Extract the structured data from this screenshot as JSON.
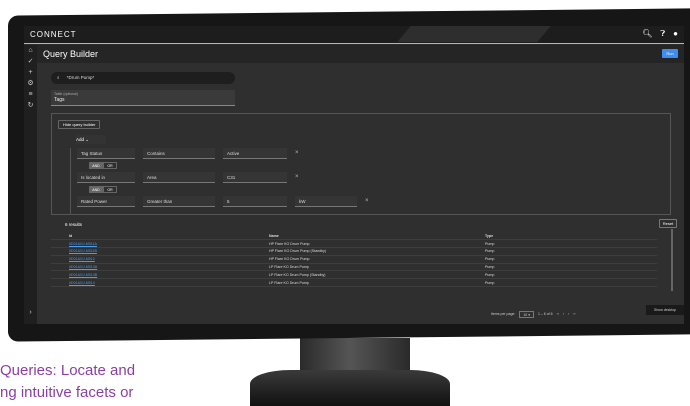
{
  "app": {
    "brand": "CONNECT",
    "title": "Query Builder",
    "run_label": "Run"
  },
  "topbar_icons": [
    "search-icon",
    "help-icon",
    "account-icon"
  ],
  "sidenav_icons": [
    "home-icon",
    "check-circle-icon",
    "plus-icon",
    "gear-icon",
    "hierarchy-icon",
    "history-icon"
  ],
  "search": {
    "value": "*Drum Pump*"
  },
  "table_field": {
    "label": "Table (optional)",
    "value": "Tags"
  },
  "query_builder": {
    "hide_label": "Hide query builder",
    "add_label": "Add",
    "rules": [
      {
        "field": "Tag Status",
        "operator": "Contains",
        "value": "Active",
        "unit": ""
      },
      {
        "field": "Is located in",
        "operator": "Area",
        "value": "C31",
        "unit": ""
      },
      {
        "field": "Rated Power",
        "operator": "Greater than",
        "value": "5",
        "unit": "kW"
      }
    ],
    "and_label": "AND",
    "or_label": "OR"
  },
  "results": {
    "count_label": "6 results",
    "reset_label": "Reset",
    "columns": [
      "Id",
      "Name",
      "Type"
    ],
    "rows": [
      {
        "id": "0D01AGJ-M011A",
        "name": "HP Flare KO Drum Pump",
        "type": "Pump"
      },
      {
        "id": "0D01AGJ-M011B",
        "name": "HP Flare KO Drum Pump (Standby)",
        "type": "Pump"
      },
      {
        "id": "0D01AGJ-M012",
        "name": "HP Flare KO Drum Pump",
        "type": "Pump"
      },
      {
        "id": "0D01AGJ-M013A",
        "name": "LP Flare KO Drum Pump",
        "type": "Pump"
      },
      {
        "id": "0D01AGJ-M013B",
        "name": "LP Flare KO Drum Pump (Standby)",
        "type": "Pump"
      },
      {
        "id": "0D01AGJ-M014",
        "name": "LP Flare KO Drum Pump",
        "type": "Pump"
      }
    ],
    "items_per_page_label": "Items per page:",
    "items_per_page": "10",
    "range": "1 – 6 of 6"
  },
  "desktop_tip": "Show desktop",
  "caption": {
    "line1": "Queries: Locate and",
    "line2": "ng intuitive facets or"
  }
}
